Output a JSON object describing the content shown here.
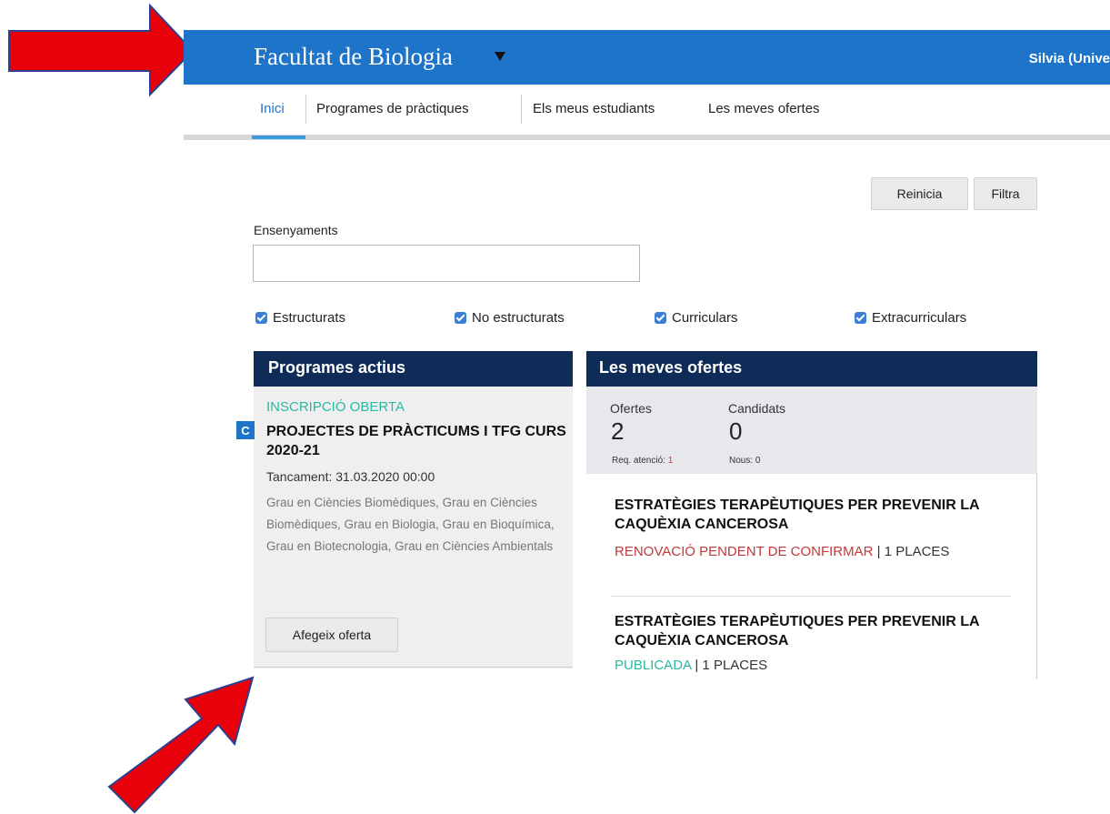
{
  "header": {
    "brand": "Facultat de Biologia",
    "user": "Silvia (Unive"
  },
  "tabs": [
    "Inici",
    "Programes de pràctiques",
    "Els meus estudiants",
    "Les meves ofertes"
  ],
  "filters": {
    "reset_label": "Reinicia",
    "filter_label": "Filtra",
    "ensenyaments_label": "Ensenyaments",
    "ensenyaments_value": "",
    "checkboxes": [
      "Estructurats",
      "No estructurats",
      "Curriculars",
      "Extracurriculars"
    ]
  },
  "programes_actius": {
    "heading": "Programes actius",
    "status": "INSCRIPCIÓ OBERTA",
    "badge": "C",
    "title": "PROJECTES DE PRÀCTICUMS I TFG CURS 2020-21",
    "closing": "Tancament: 31.03.2020 00:00",
    "grades": "Grau en Ciències Biomèdiques, Grau en Ciències Biomèdiques, Grau en Biologia, Grau en Bioquímica, Grau en Biotecnologia, Grau en Ciències Ambientals",
    "add_button": "Afegeix oferta"
  },
  "meves_ofertes": {
    "heading": "Les meves ofertes",
    "ofertes_label": "Ofertes",
    "ofertes_count": "2",
    "req_label": "Req. atenció: ",
    "req_count": "1",
    "candidats_label": "Candidats",
    "candidats_count": "0",
    "nous_label": "Nous: 0",
    "offers": [
      {
        "title": "ESTRATÈGIES TERAPÈUTIQUES PER PREVENIR LA CAQUÈXIA CANCEROSA",
        "status": "RENOVACIÓ PENDENT DE CONFIRMAR",
        "places": " | 1 PLACES",
        "status_color": "#c0393b"
      },
      {
        "title": "ESTRATÈGIES TERAPÈUTIQUES PER PREVENIR LA CAQUÈXIA CANCEROSA",
        "status": "PUBLICADA",
        "places": " | 1 PLACES",
        "status_color": "#2bb8a0"
      }
    ]
  },
  "colors": {
    "header_blue": "#1d74c9",
    "panel_navy": "#0f2b57",
    "accent_teal": "#2bb8a0",
    "alert_red": "#c0393b",
    "annotation_arrow": "#e8000b"
  }
}
